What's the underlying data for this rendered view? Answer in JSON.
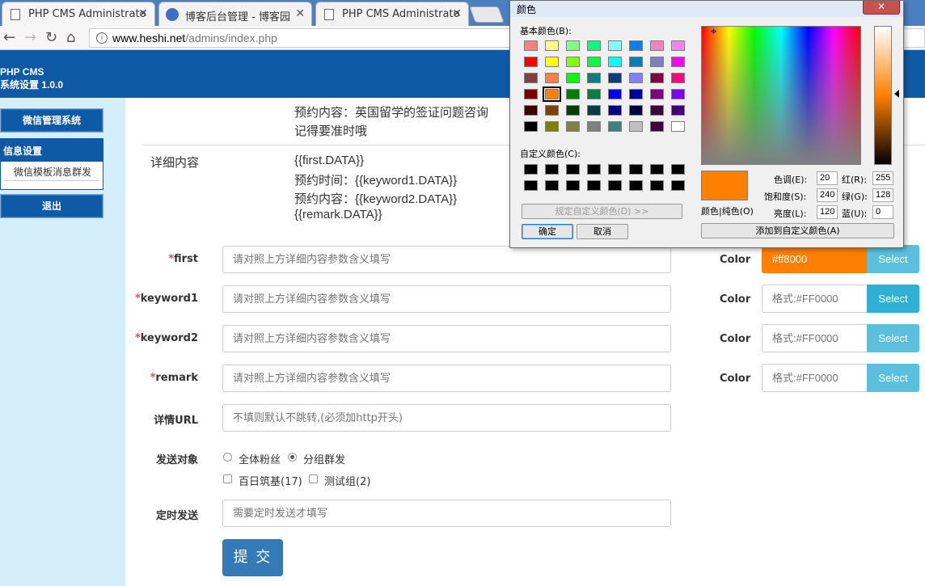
{
  "browser": {
    "tabs": [
      {
        "title": "PHP CMS Administrato",
        "close": "✕"
      },
      {
        "title": "博客后台管理 - 博客园",
        "close": "✕"
      },
      {
        "title": "PHP CMS Administrato",
        "close": "✕"
      }
    ],
    "url_host": "www.heshi.net",
    "url_path": "/admins/index.php"
  },
  "app": {
    "title_line1": "PHP CMS",
    "title_line2": "系统设置 1.0.0"
  },
  "sidebar": {
    "top_button": "微信管理系统",
    "group_title": "信息设置",
    "group_item": "微信模板消息群发",
    "logout_button": "退出"
  },
  "content": {
    "booking_content": "预约内容：英国留学的签证问题咨询",
    "reminder": "记得要准时哦",
    "detail_label": "详细内容",
    "detail_lines": [
      "{{first.DATA}}",
      "预约时间：{{keyword1.DATA}}",
      "预约内容：{{keyword2.DATA}}",
      "{{remark.DATA}}"
    ]
  },
  "form": {
    "required_mark": "*",
    "fields": [
      {
        "label": "first",
        "placeholder": "请对照上方详细内容参数含义填写",
        "color_value": "#ff8000",
        "color_placeholder": "格式:#FF0000"
      },
      {
        "label": "keyword1",
        "placeholder": "请对照上方详细内容参数含义填写",
        "color_value": "",
        "color_placeholder": "格式:#FF0000"
      },
      {
        "label": "keyword2",
        "placeholder": "请对照上方详细内容参数含义填写",
        "color_value": "",
        "color_placeholder": "格式:#FF0000"
      },
      {
        "label": "remark",
        "placeholder": "请对照上方详细内容参数含义填写",
        "color_value": "",
        "color_placeholder": "格式:#FF0000"
      }
    ],
    "color_label": "Color",
    "select_label": "Select",
    "url_label": "详情URL",
    "url_placeholder": "不填则默认不跳转,(必须加http开头)",
    "target_label": "发送对象",
    "radio_all": "全体粉丝",
    "radio_group": "分组群发",
    "group_options": [
      "百日筑基(17)",
      "测试组(2)"
    ],
    "schedule_label": "定时发送",
    "schedule_placeholder": "需要定时发送才填写",
    "submit_label": "提 交"
  },
  "color_dialog": {
    "title": "颜色",
    "close": "✕",
    "basic_label": "基本颜色(B):",
    "custom_label": "自定义颜色(C):",
    "define_button": "规定自定义颜色(D) >>",
    "ok_button": "确定",
    "cancel_button": "取消",
    "preview_label": "颜色|纯色(O)",
    "hue_label": "色调(E):",
    "hue": "20",
    "sat_label": "饱和度(S):",
    "sat": "240",
    "lum_label": "亮度(L):",
    "lum": "120",
    "red_label": "红(R):",
    "red": "255",
    "green_label": "绿(G):",
    "green": "128",
    "blue_label": "蓝(U):",
    "blue": "0",
    "add_button": "添加到自定义颜色(A)",
    "basic_colors": [
      "#ff8080",
      "#ffff80",
      "#80ff80",
      "#00ff80",
      "#80ffff",
      "#0080ff",
      "#ff80c0",
      "#ff80ff",
      "#ff0000",
      "#ffff00",
      "#80ff00",
      "#00ff40",
      "#00ffff",
      "#0080c0",
      "#8080c0",
      "#ff00ff",
      "#804040",
      "#ff8040",
      "#00ff00",
      "#008080",
      "#004080",
      "#8080ff",
      "#800040",
      "#ff0080",
      "#800000",
      "#ff8000",
      "#008000",
      "#008040",
      "#0000ff",
      "#0000a0",
      "#800080",
      "#8000ff",
      "#400000",
      "#804000",
      "#004000",
      "#004040",
      "#000080",
      "#000040",
      "#400040",
      "#400080",
      "#000000",
      "#808000",
      "#808040",
      "#808080",
      "#408080",
      "#c0c0c0",
      "#400040",
      "#ffffff"
    ],
    "selected_index": 25
  }
}
